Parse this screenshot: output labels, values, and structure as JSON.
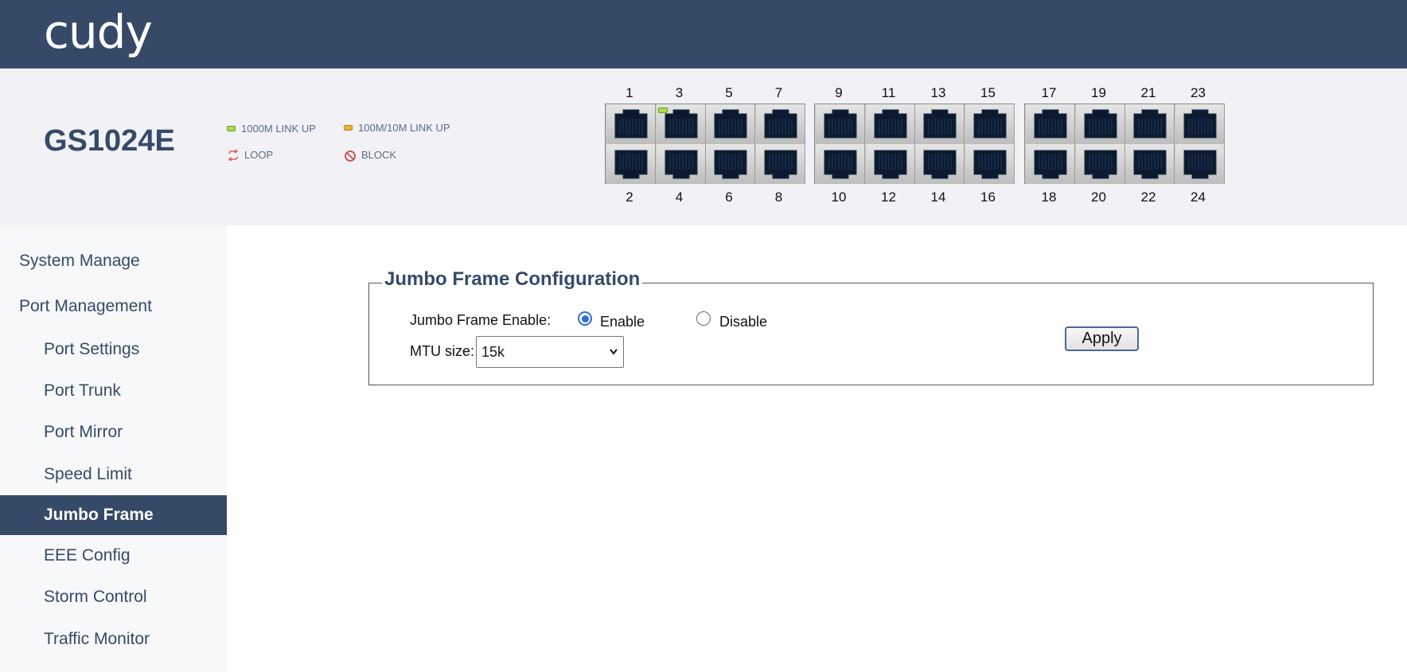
{
  "brand": {
    "logo_text": "cudy"
  },
  "device": {
    "model": "GS1024E",
    "legend": {
      "link_1000": "1000M LINK UP",
      "link_100": "100M/10M LINK UP",
      "loop": "LOOP",
      "block": "BLOCK"
    },
    "ports_top": [
      "1",
      "3",
      "5",
      "7",
      "9",
      "11",
      "13",
      "15",
      "17",
      "19",
      "21",
      "23"
    ],
    "ports_bottom": [
      "2",
      "4",
      "6",
      "8",
      "10",
      "12",
      "14",
      "16",
      "18",
      "20",
      "22",
      "24"
    ],
    "active_ports": [
      "3"
    ]
  },
  "sidebar": {
    "items": [
      {
        "label": "System Manage"
      },
      {
        "label": "Port Management"
      },
      {
        "label": "Port Settings"
      },
      {
        "label": "Port Trunk"
      },
      {
        "label": "Port Mirror"
      },
      {
        "label": "Speed Limit"
      },
      {
        "label": "Jumbo Frame"
      },
      {
        "label": "EEE Config"
      },
      {
        "label": "Storm Control"
      },
      {
        "label": "Traffic Monitor"
      }
    ]
  },
  "jumbo": {
    "title": "Jumbo Frame Configuration",
    "enable_label": "Jumbo Frame Enable:",
    "enable_option": "Enable",
    "disable_option": "Disable",
    "selected": "Enable",
    "mtu_label": "MTU size:",
    "mtu_value": "15k",
    "apply_label": "Apply"
  },
  "colors": {
    "header": "#364a68",
    "accent": "#2d6fd6",
    "link_green": "#a6e04a",
    "link_orange": "#f2b33c"
  }
}
